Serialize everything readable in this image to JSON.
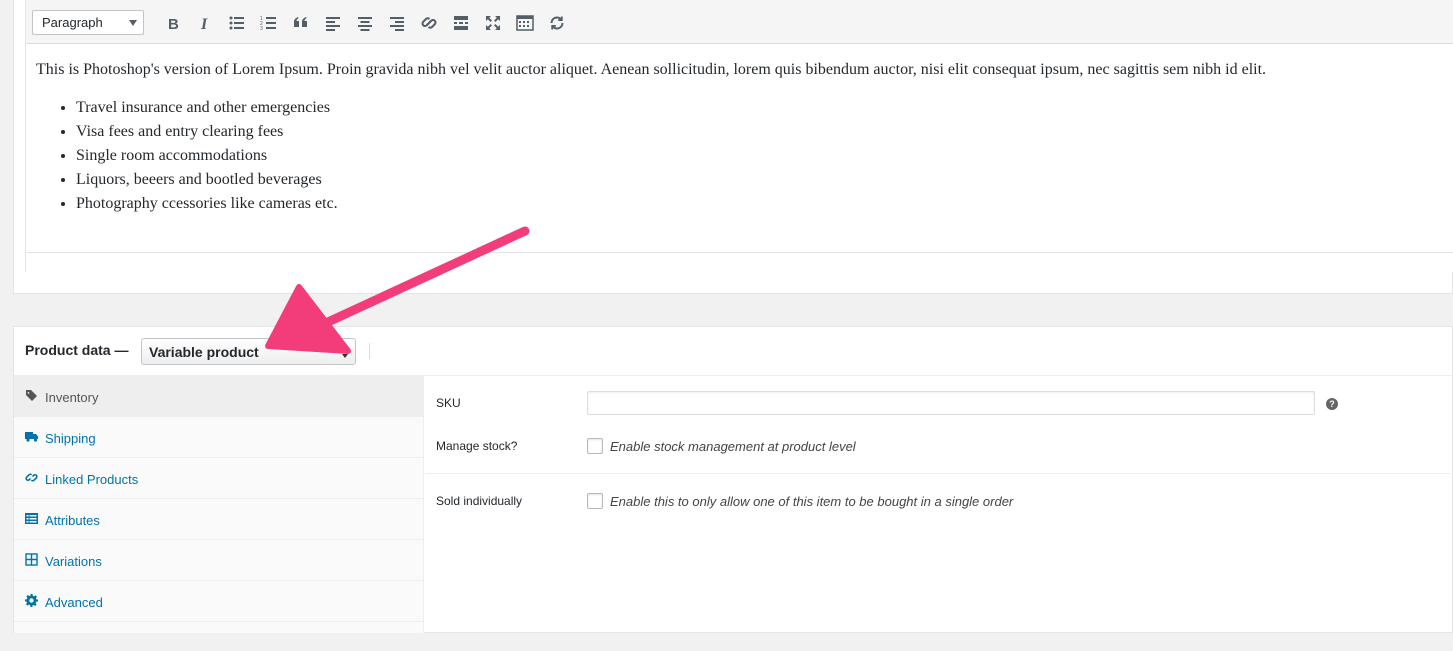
{
  "editor": {
    "format_select": "Paragraph",
    "toolbar_icons": [
      "bold-icon",
      "italic-icon",
      "bullet-list-icon",
      "numbered-list-icon",
      "blockquote-icon",
      "align-left-icon",
      "align-center-icon",
      "align-right-icon",
      "link-icon",
      "read-more-icon",
      "fullscreen-icon",
      "toolbar-toggle-icon",
      "refresh-icon"
    ],
    "paragraph": "This is Photoshop's version of Lorem Ipsum. Proin gravida nibh vel velit auctor aliquet. Aenean sollicitudin, lorem quis bibendum auctor, nisi elit consequat ipsum, nec sagittis sem nibh id elit.",
    "list": [
      "Travel insurance and other emergencies",
      "Visa fees and entry clearing fees",
      "Single room accommodations",
      "Liquors, beeers and bootled beverages",
      "Photography ccessories like cameras etc."
    ]
  },
  "product_data": {
    "title": "Product data —",
    "type_select": "Variable product",
    "tabs": [
      {
        "label": "Inventory",
        "icon": "tag-icon",
        "active": true
      },
      {
        "label": "Shipping",
        "icon": "truck-icon"
      },
      {
        "label": "Linked Products",
        "icon": "link-icon"
      },
      {
        "label": "Attributes",
        "icon": "list-icon"
      },
      {
        "label": "Variations",
        "icon": "grid-icon"
      },
      {
        "label": "Advanced",
        "icon": "gear-icon"
      }
    ],
    "fields": {
      "sku_label": "SKU",
      "sku_value": "",
      "help": "?",
      "manage_stock_label": "Manage stock?",
      "manage_stock_checkbox": "Enable stock management at product level",
      "sold_individually_label": "Sold individually",
      "sold_individually_checkbox": "Enable this to only allow one of this item to be bought in a single order"
    }
  },
  "colors": {
    "link": "#0073aa",
    "annotation_arrow": "#f23d7a"
  }
}
